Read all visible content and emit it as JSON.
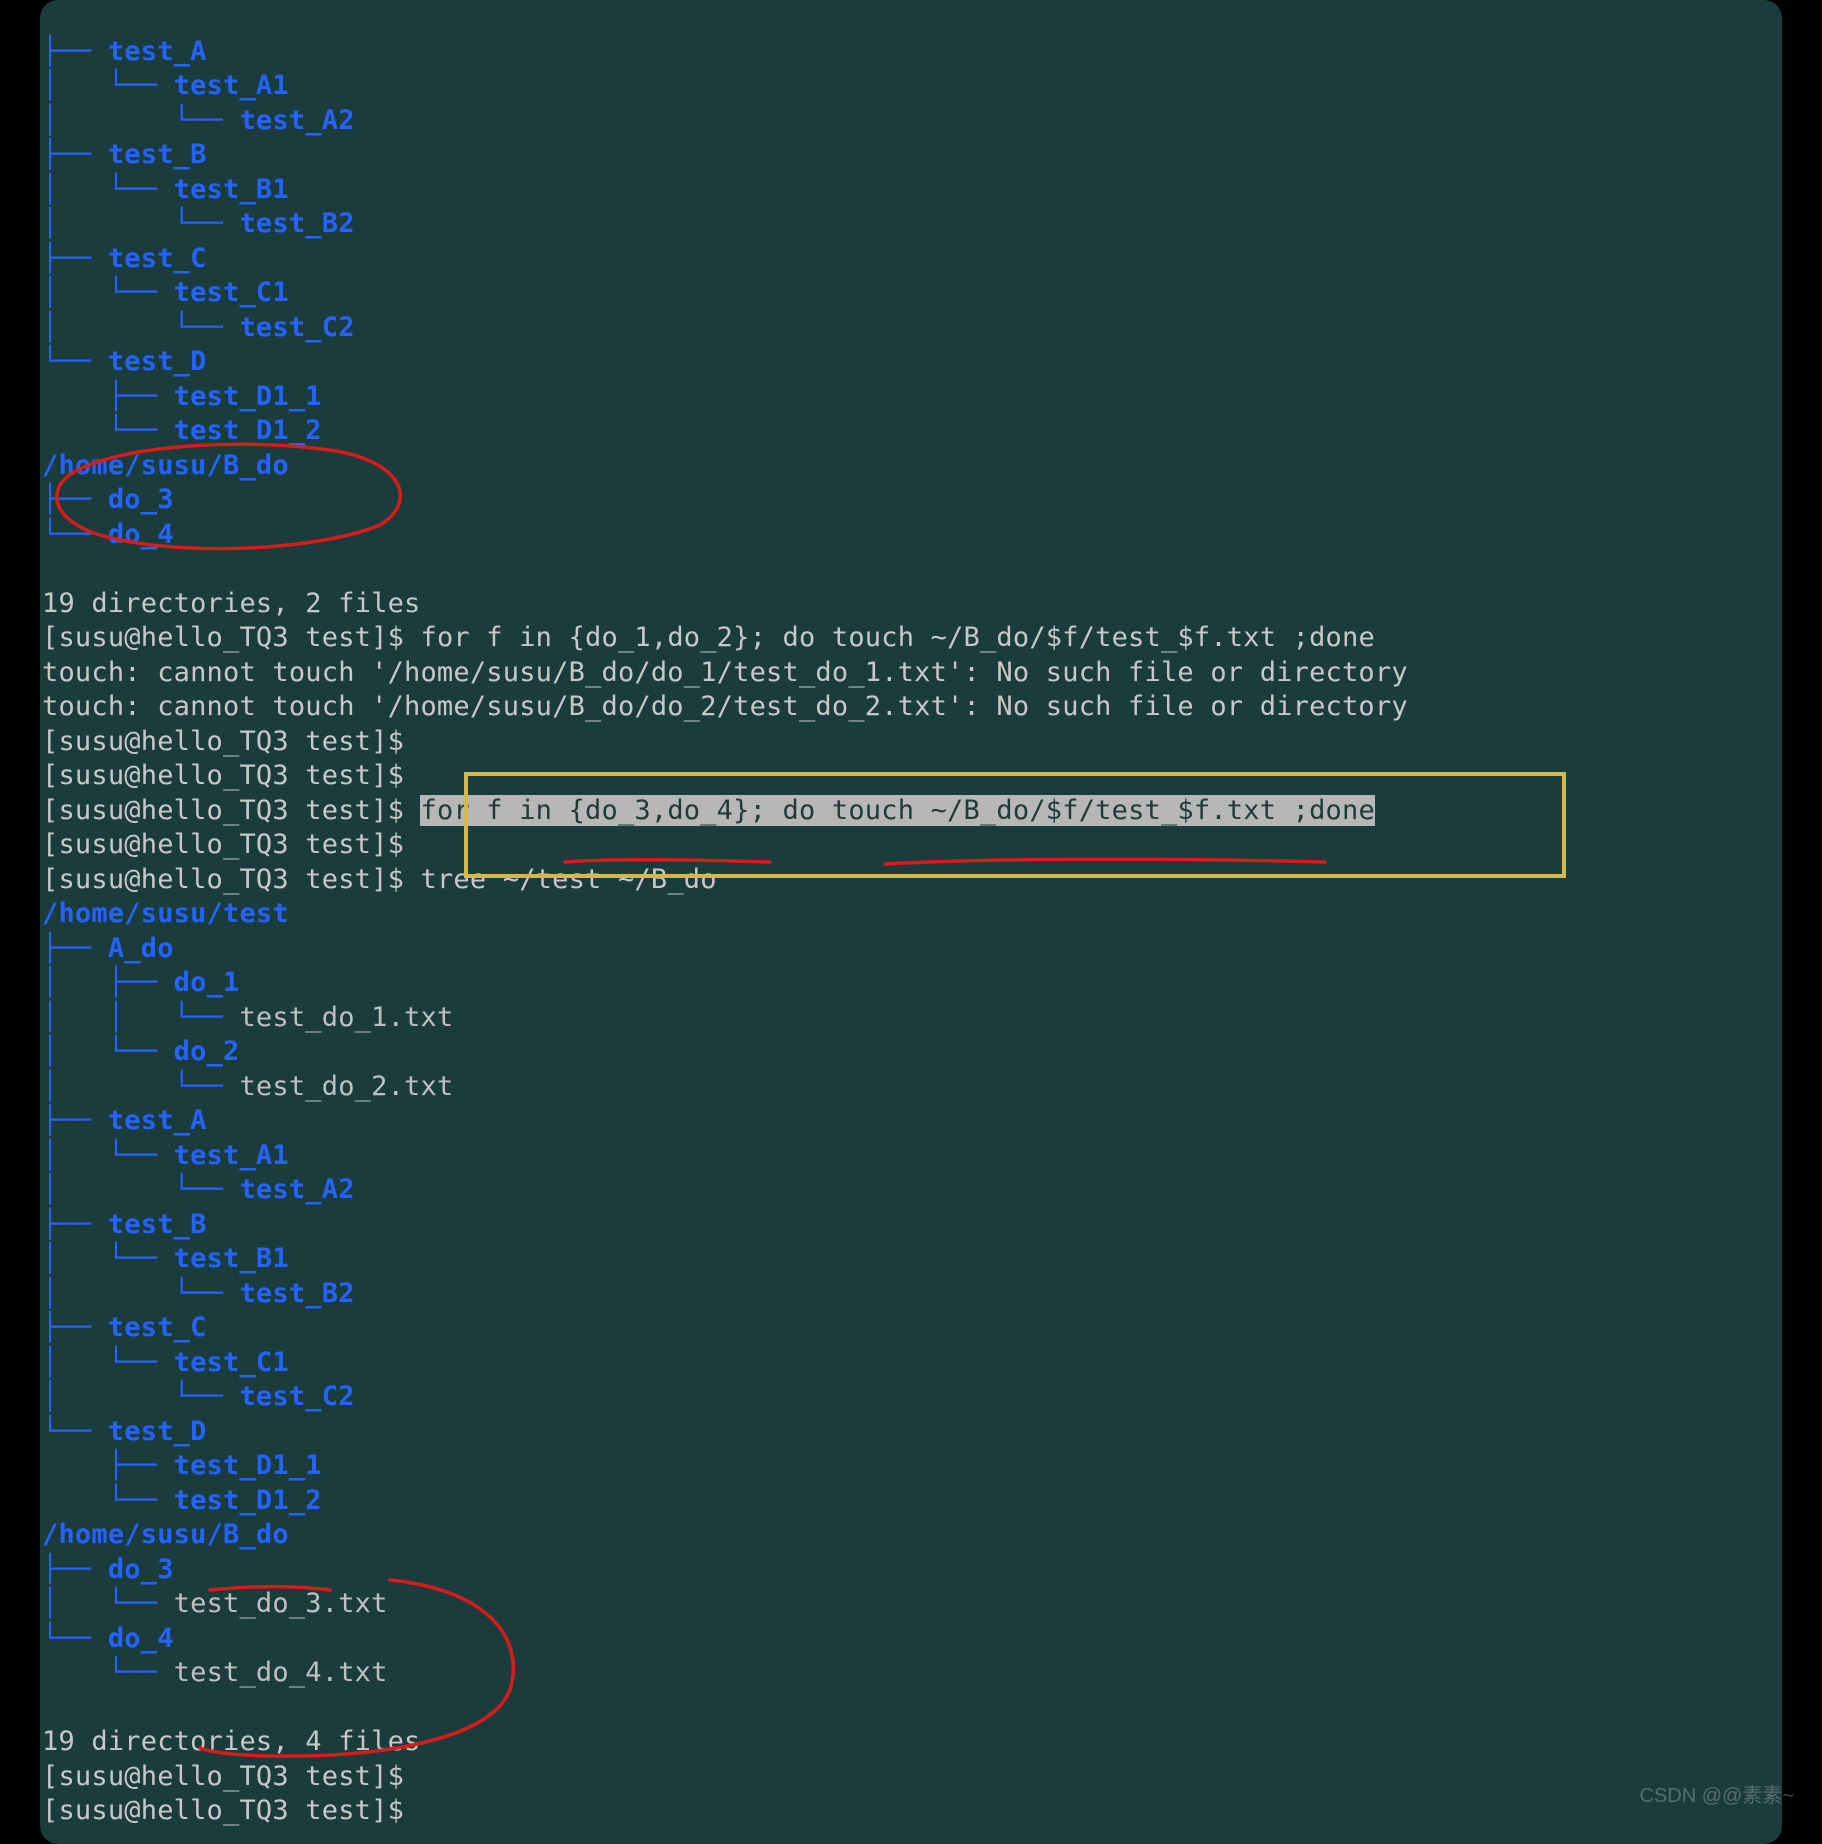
{
  "tree1": {
    "l01": "├── test_A",
    "l02": "│   └── test_A1",
    "l03": "│       └── test_A2",
    "l04": "├── test_B",
    "l05": "│   └── test_B1",
    "l06": "│       └── test_B2",
    "l07": "├── test_C",
    "l08": "│   └── test_C1",
    "l09": "│       └── test_C2",
    "l10": "└── test_D",
    "l11": "    ├── test_D1_1",
    "l12": "    └── test_D1_2",
    "l13": "/home/susu/B_do",
    "l14": "├── do_3",
    "l15": "└── do_4"
  },
  "mid": {
    "blank1": "",
    "summary1": "19 directories, 2 files",
    "p1": "[susu@hello_TQ3 test]$ ",
    "cmd1": "for f in {do_1,do_2}; do touch ~/B_do/$f/test_$f.txt ;done",
    "err1": "touch: cannot touch '/home/susu/B_do/do_1/test_do_1.txt': No such file or directory",
    "err2": "touch: cannot touch '/home/susu/B_do/do_2/test_do_2.txt': No such file or directory",
    "p2": "[susu@hello_TQ3 test]$ ",
    "p3": "[susu@hello_TQ3 test]$",
    "p4": "[susu@hello_TQ3 test]$ ",
    "cmd2": "for f in {do_3,do_4}; do touch ~/B_do/$f/test_$f.txt ;done",
    "p5": "[susu@hello_TQ3 test]$ ",
    "p6": "[susu@hello_TQ3 test]$ ",
    "cmd3": "tree ~/test ~/B_do"
  },
  "tree2": {
    "l00": "/home/susu/test",
    "l01_a": "├── ",
    "l01_b": "A_do",
    "l02_a": "│   ├── ",
    "l02_b": "do_1",
    "l03_a": "│   │   └── ",
    "l03_b": "test_do_1.txt",
    "l04_a": "│   └── ",
    "l04_b": "do_2",
    "l05_a": "│       └── ",
    "l05_b": "test_do_2.txt",
    "l06": "├── test_A",
    "l07": "│   └── test_A1",
    "l08": "│       └── test_A2",
    "l09": "├── test_B",
    "l10": "│   └── test_B1",
    "l11": "│       └── test_B2",
    "l12": "├── test_C",
    "l13": "│   └── test_C1",
    "l14": "│       └── test_C2",
    "l15": "└── test_D",
    "l16": "    ├── test_D1_1",
    "l17": "    └── test_D1_2",
    "l18": "/home/susu/B_do",
    "l19_a": "├── ",
    "l19_b": "do_3",
    "l20_a": "│   └── ",
    "l20_b": "test_do_3.txt",
    "l21_a": "└── ",
    "l21_b": "do_4",
    "l22_a": "    └── ",
    "l22_b": "test_do_4.txt"
  },
  "end": {
    "blank2": "",
    "summary2": "19 directories, 4 files",
    "p7": "[susu@hello_TQ3 test]$ ",
    "p8": "[susu@hello_TQ3 test]$ "
  },
  "watermark": "CSDN @@素素~"
}
